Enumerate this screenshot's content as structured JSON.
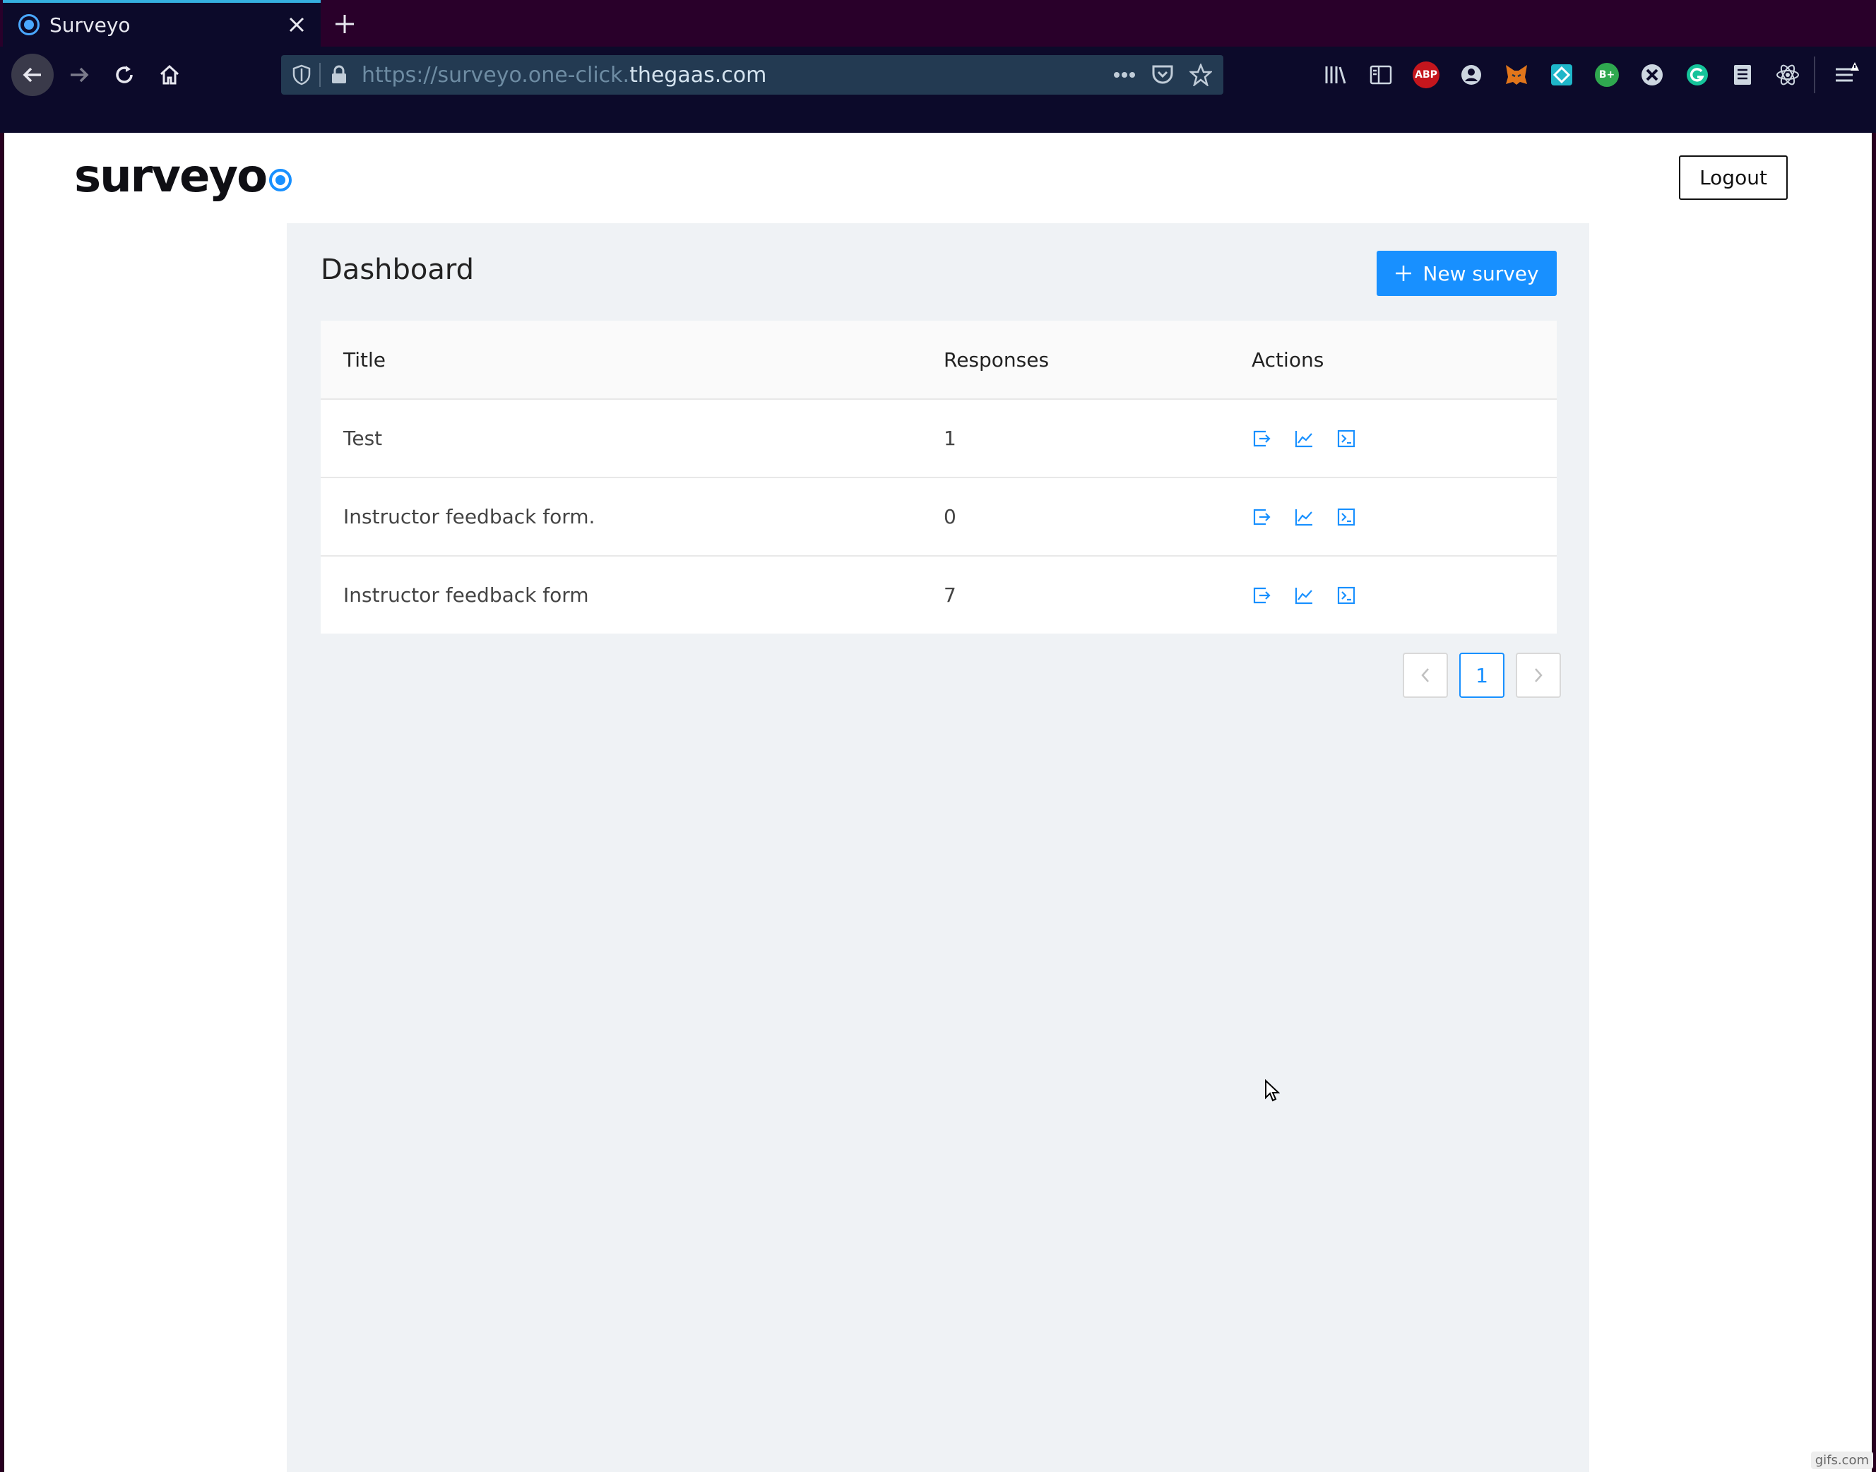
{
  "browser": {
    "tab_title": "Surveyo",
    "url_prefix": "https://surveyo.one-click.",
    "url_host": "thegaas.com",
    "extensions": [
      "library-icon",
      "reader-icon",
      "adblock-plus-icon",
      "account-icon",
      "metamask-icon",
      "extension-icon",
      "b-plus-icon",
      "puzzle-icon",
      "grammarly-icon",
      "notes-icon",
      "react-devtools-icon"
    ],
    "extension_labels": {
      "adblock": "ABP",
      "bplus": "B+"
    }
  },
  "header": {
    "logo_text": "surveyo",
    "logout_label": "Logout"
  },
  "dashboard": {
    "title": "Dashboard",
    "new_survey_label": "New survey",
    "columns": {
      "title": "Title",
      "responses": "Responses",
      "actions": "Actions"
    },
    "rows": [
      {
        "title": "Test",
        "responses": "1"
      },
      {
        "title": "Instructor feedback form.",
        "responses": "0"
      },
      {
        "title": "Instructor feedback form",
        "responses": "7"
      }
    ],
    "pagination": {
      "current_page": "1"
    }
  },
  "colors": {
    "accent": "#1890ff",
    "panel_bg": "#eff2f5",
    "chrome_bg": "#0c0a2a",
    "tab_strip": "#29002a"
  },
  "watermark": "gifs.com"
}
